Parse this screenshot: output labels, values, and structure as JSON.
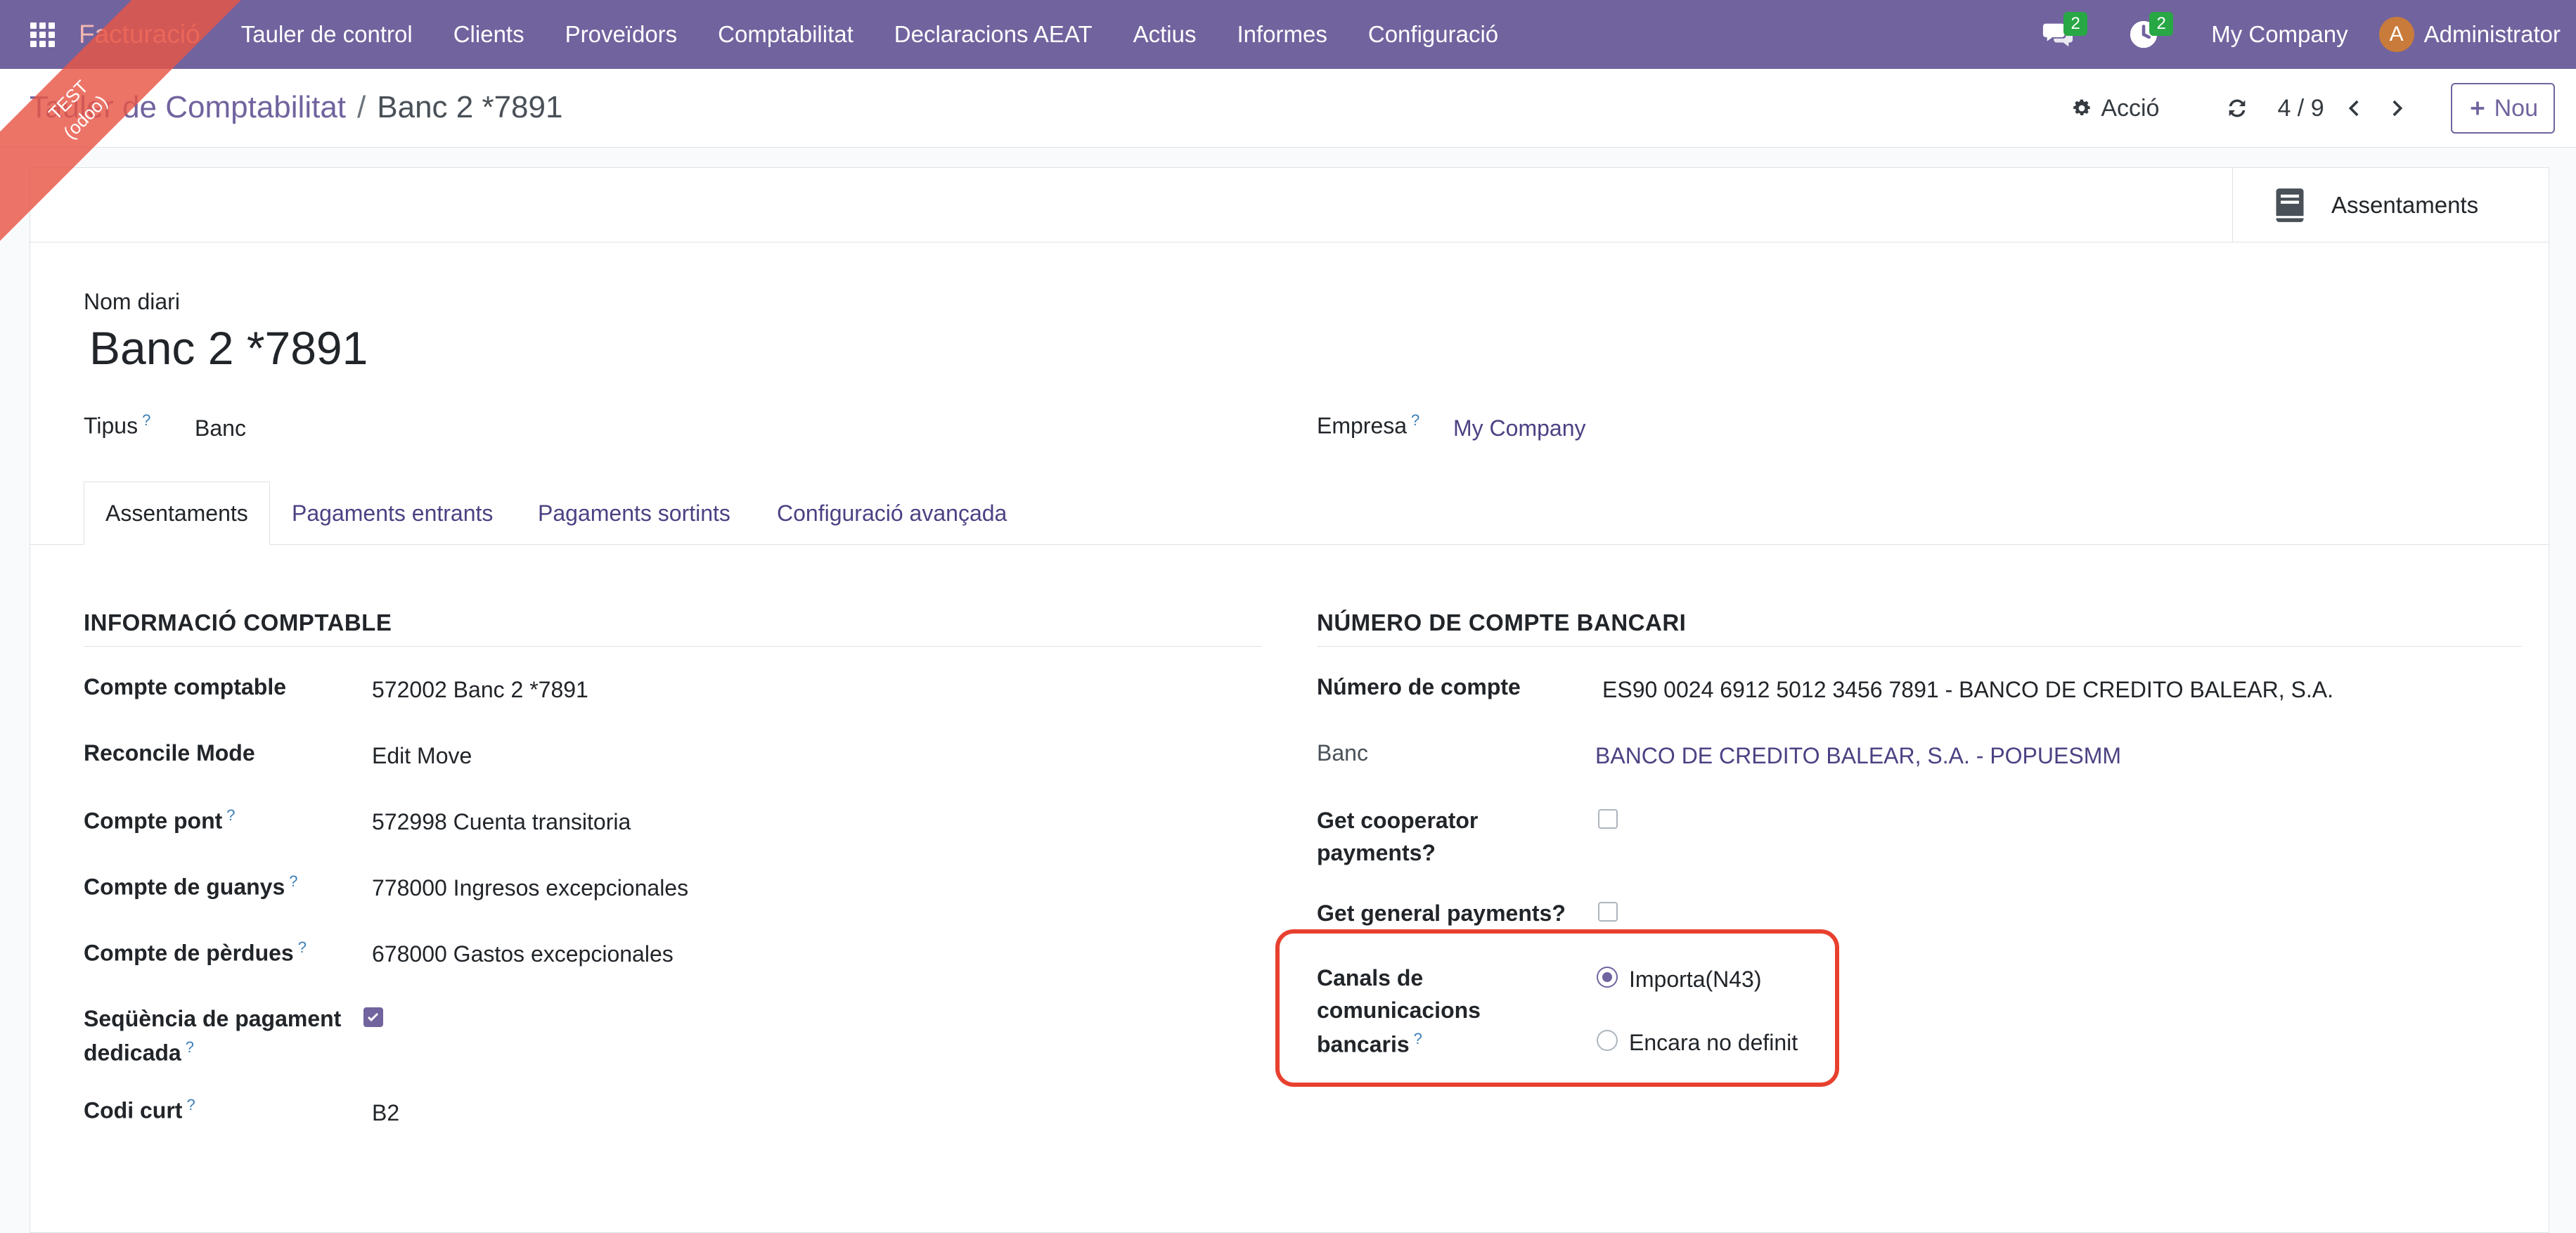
{
  "navbar": {
    "brand": "Facturació",
    "menu": [
      "Tauler de control",
      "Clients",
      "Proveïdors",
      "Comptabilitat",
      "Declaracions AEAT",
      "Actius",
      "Informes",
      "Configuració"
    ],
    "messages_badge": "2",
    "activities_badge": "2",
    "company": "My Company",
    "user_initial": "A",
    "user_name": "Administrator"
  },
  "ribbon": {
    "line1": "TEST",
    "line2": "(odoo)"
  },
  "breadcrumb": {
    "parent": "Tauler de Comptabilitat",
    "separator": "/",
    "current": "Banc 2 *7891"
  },
  "control": {
    "action_label": "Acció",
    "pager": "4 / 9",
    "new_label": "Nou"
  },
  "smart_button": {
    "label": "Assentaments"
  },
  "form": {
    "name_label": "Nom diari",
    "name_value": "Banc 2 *7891",
    "type_label": "Tipus",
    "type_value": "Banc",
    "company_label": "Empresa",
    "company_value": "My Company",
    "help_mark": "?"
  },
  "tabs": [
    "Assentaments",
    "Pagaments entrants",
    "Pagaments sortints",
    "Configuració avançada"
  ],
  "accounting": {
    "title": "INFORMACIÓ COMPTABLE",
    "account_label": "Compte comptable",
    "account_value": "572002 Banc 2 *7891",
    "reconcile_label": "Reconcile Mode",
    "reconcile_value": "Edit Move",
    "bridge_label": "Compte pont",
    "bridge_value": "572998 Cuenta transitoria",
    "profit_label": "Compte de guanys",
    "profit_value": "778000 Ingresos excepcionales",
    "loss_label": "Compte de pèrdues",
    "loss_value": "678000 Gastos excepcionales",
    "sequence_label_1": "Seqüència de pagament",
    "sequence_label_2": "dedicada",
    "sequence_checked": true,
    "code_label": "Codi curt",
    "code_value": "B2"
  },
  "bank": {
    "title": "NÚMERO DE COMPTE BANCARI",
    "number_label": "Número de compte",
    "number_value": "ES90 0024 6912 5012 3456 7891 - BANCO DE CREDITO BALEAR, S.A.",
    "bank_label": "Banc",
    "bank_value": "BANCO DE CREDITO BALEAR, S.A. - POPUESMM",
    "coop_label_1": "Get cooperator",
    "coop_label_2": "payments?",
    "coop_checked": false,
    "general_label": "Get general payments?",
    "general_checked": false,
    "channels_label_1": "Canals de",
    "channels_label_2": "comunicacions",
    "channels_label_3": "bancaris",
    "channel_options": [
      "Importa(N43)",
      "Encara no definit"
    ],
    "channel_selected": "Importa(N43)"
  },
  "colors": {
    "navbar": "#71639e",
    "accent": "#71639e",
    "highlight": "#e8402f",
    "badge": "#28a745"
  }
}
